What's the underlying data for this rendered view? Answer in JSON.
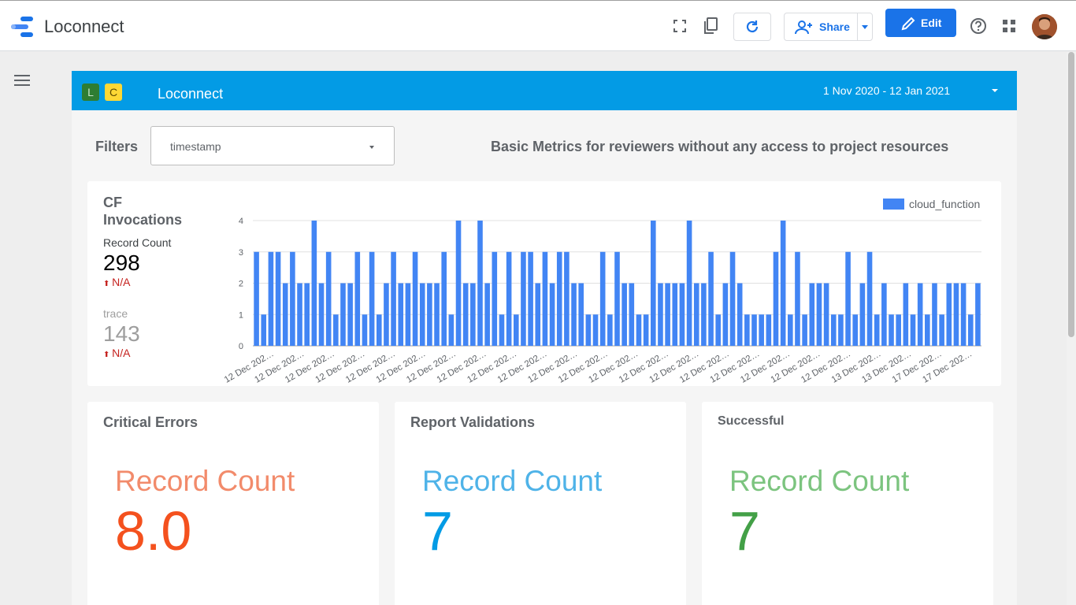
{
  "app": {
    "title": "Loconnect"
  },
  "toolbar": {
    "share_label": "Share",
    "edit_label": "Edit"
  },
  "report": {
    "badge_l": "L",
    "badge_c": "C",
    "title": "Loconnect",
    "date_range": "1 Nov 2020 - 12 Jan 2021"
  },
  "filters": {
    "label": "Filters",
    "control_value": "timestamp"
  },
  "subtitle": "Basic Metrics for reviewers without any access to project resources",
  "cf_card": {
    "title": "CF Invocations",
    "scorecards": [
      {
        "label": "Record Count",
        "value": "298",
        "delta": "N/A"
      },
      {
        "label": "trace",
        "value": "143",
        "delta": "N/A"
      }
    ]
  },
  "chart_data": {
    "type": "bar",
    "title": "",
    "xlabel": "",
    "ylabel": "",
    "ylim": [
      0,
      4
    ],
    "yticks": [
      0,
      1,
      2,
      3,
      4
    ],
    "grid": true,
    "legend": "top-right",
    "series": [
      {
        "name": "cloud_function",
        "color": "#4285f4",
        "values": [
          3,
          1,
          3,
          3,
          2,
          3,
          2,
          2,
          4,
          2,
          3,
          1,
          2,
          2,
          3,
          1,
          3,
          1,
          2,
          3,
          2,
          2,
          3,
          2,
          2,
          2,
          3,
          1,
          4,
          2,
          2,
          4,
          2,
          3,
          1,
          3,
          1,
          3,
          3,
          2,
          3,
          2,
          3,
          3,
          2,
          2,
          1,
          1,
          3,
          1,
          3,
          2,
          2,
          1,
          1,
          4,
          2,
          2,
          2,
          2,
          4,
          2,
          2,
          3,
          1,
          2,
          3,
          2,
          1,
          1,
          1,
          1,
          3,
          4,
          1,
          3,
          1,
          2,
          2,
          2,
          1,
          1,
          3,
          1,
          2,
          3,
          1,
          2,
          1,
          1,
          2,
          1,
          2,
          1,
          2,
          1,
          2,
          2,
          2,
          1,
          2
        ]
      }
    ],
    "tick_labels": [
      "12 Dec 202…",
      "12 Dec 202…",
      "12 Dec 202…",
      "12 Dec 202…",
      "12 Dec 202…",
      "12 Dec 202…",
      "12 Dec 202…",
      "12 Dec 202…",
      "12 Dec 202…",
      "12 Dec 202…",
      "12 Dec 202…",
      "12 Dec 202…",
      "12 Dec 202…",
      "12 Dec 202…",
      "12 Dec 202…",
      "12 Dec 202…",
      "12 Dec 202…",
      "12 Dec 202…",
      "12 Dec 202…",
      "12 Dec 202…",
      "13 Dec 202…",
      "13 Dec 202…",
      "17 Dec 202…",
      "17 Dec 202…"
    ]
  },
  "metrics": [
    {
      "title": "Critical Errors",
      "label": "Record Count",
      "value": "8.0",
      "label_color": "#f28b6b",
      "value_color": "#f4511e"
    },
    {
      "title": "Report Validations",
      "label": "Record Count",
      "value": "7",
      "label_color": "#4fb3e8",
      "value_color": "#039be5"
    },
    {
      "title": "Successful",
      "label": "Record Count",
      "value": "7",
      "label_color": "#7cc47f",
      "value_color": "#43a047"
    }
  ]
}
